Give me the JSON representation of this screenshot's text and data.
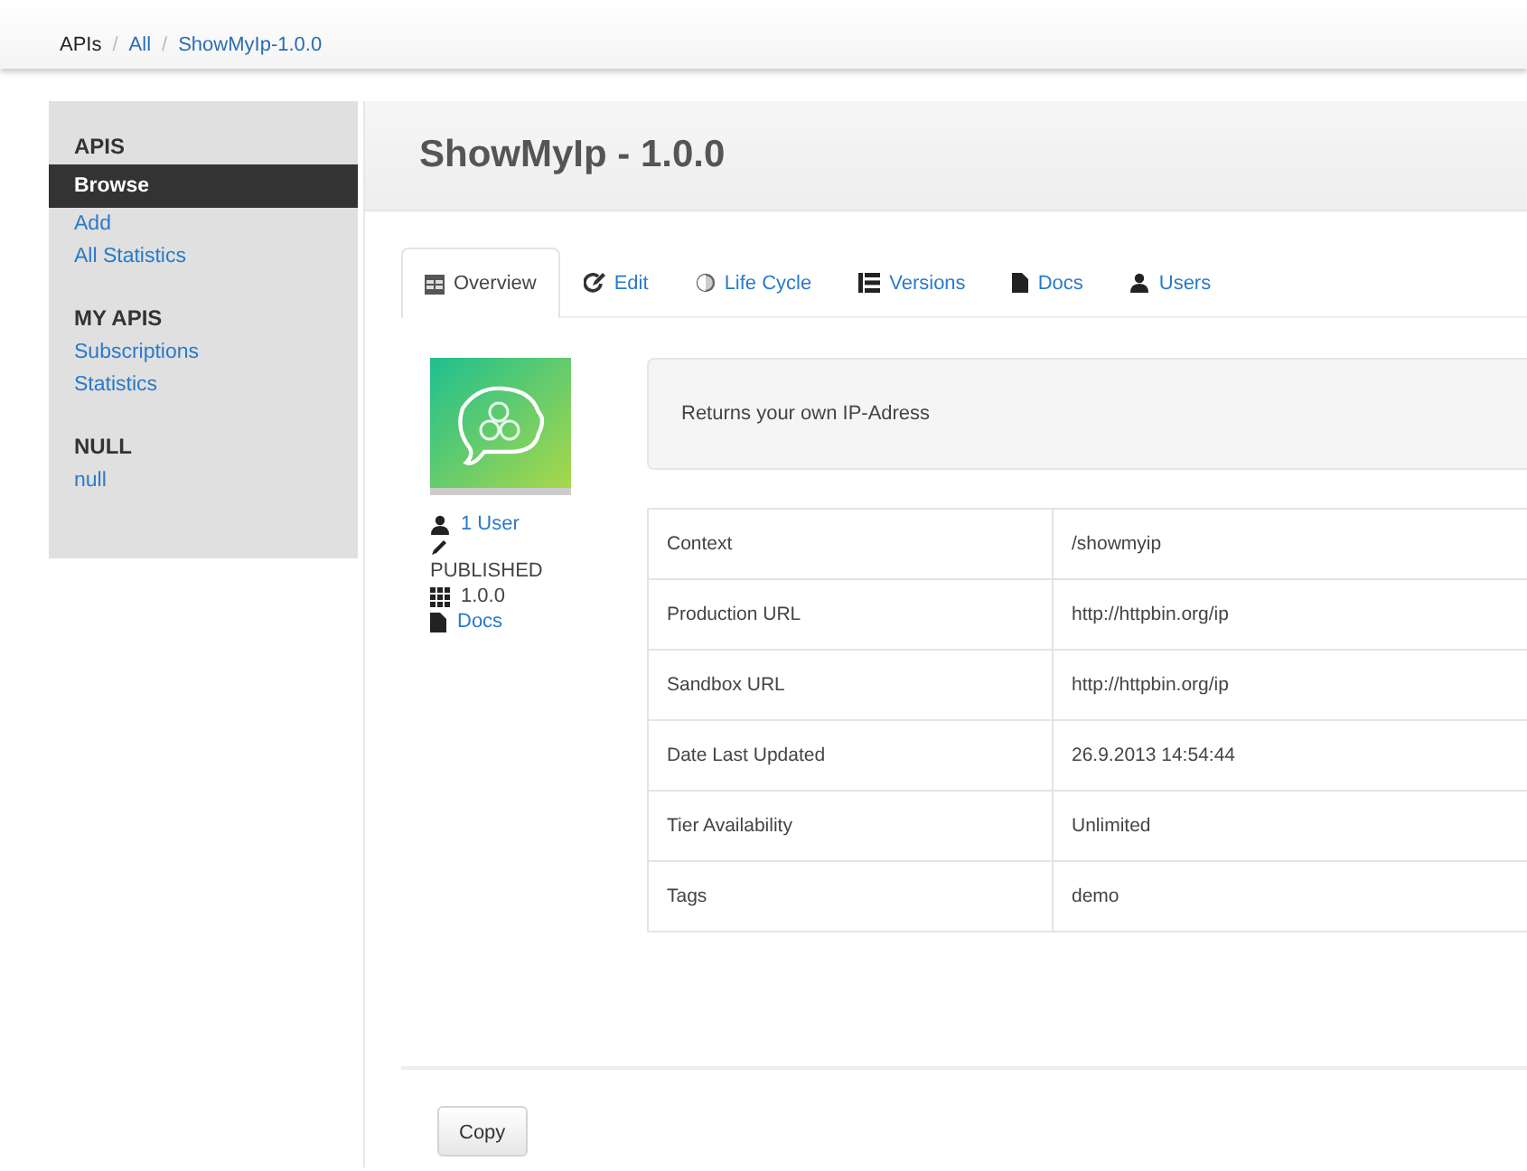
{
  "breadcrumb": [
    {
      "label": "APIs",
      "link": false
    },
    {
      "label": "All",
      "link": true
    },
    {
      "label": "ShowMyIp-1.0.0",
      "link": true
    }
  ],
  "breadcrumb_separator": "/",
  "sidebar": {
    "sections": [
      {
        "heading": "APIS",
        "items": [
          {
            "label": "Browse",
            "selected": true
          },
          {
            "label": "Add",
            "selected": false
          },
          {
            "label": "All Statistics",
            "selected": false
          }
        ]
      },
      {
        "heading": "MY APIS",
        "items": [
          {
            "label": "Subscriptions",
            "selected": false
          },
          {
            "label": "Statistics",
            "selected": false
          }
        ]
      },
      {
        "heading": "NULL",
        "items": [
          {
            "label": "null",
            "selected": false
          }
        ]
      }
    ]
  },
  "title": "ShowMyIp - 1.0.0",
  "tabs": [
    {
      "label": "Overview",
      "kind": "overview",
      "selected": true
    },
    {
      "label": "Edit",
      "kind": "edit",
      "selected": false
    },
    {
      "label": "Life Cycle",
      "kind": "lifecycle",
      "selected": false
    },
    {
      "label": "Versions",
      "kind": "versions",
      "selected": false
    },
    {
      "label": "Docs",
      "kind": "docs",
      "selected": false
    },
    {
      "label": "Users",
      "kind": "users",
      "selected": false
    }
  ],
  "meta": [
    {
      "kind": "users",
      "text": "1 User",
      "link": true
    },
    {
      "kind": "status",
      "text": "PUBLISHED",
      "link": false
    },
    {
      "kind": "version",
      "text": "1.0.0",
      "link": false
    },
    {
      "kind": "docs",
      "text": "Docs",
      "link": true
    }
  ],
  "description": "Returns your own IP-Adress",
  "details": [
    {
      "label": "Context",
      "value": "/showmyip"
    },
    {
      "label": "Production URL",
      "value": "http://httpbin.org/ip"
    },
    {
      "label": "Sandbox URL",
      "value": "http://httpbin.org/ip"
    },
    {
      "label": "Date Last Updated",
      "value": "26.9.2013 14:54:44"
    },
    {
      "label": "Tier Availability",
      "value": "Unlimited"
    },
    {
      "label": "Tags",
      "value": "demo"
    }
  ],
  "buttons": [
    "Copy"
  ]
}
